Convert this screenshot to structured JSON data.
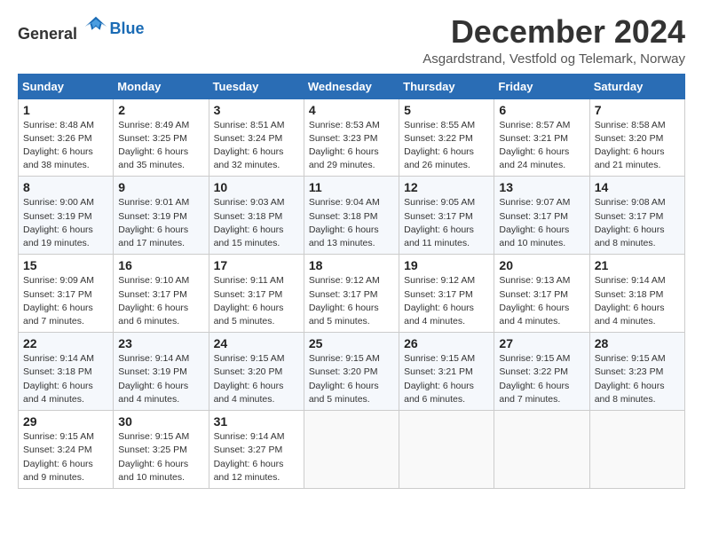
{
  "header": {
    "logo_general": "General",
    "logo_blue": "Blue",
    "title": "December 2024",
    "subtitle": "Asgardstrand, Vestfold og Telemark, Norway"
  },
  "weekdays": [
    "Sunday",
    "Monday",
    "Tuesday",
    "Wednesday",
    "Thursday",
    "Friday",
    "Saturday"
  ],
  "weeks": [
    [
      {
        "day": 1,
        "sunrise": "Sunrise: 8:48 AM",
        "sunset": "Sunset: 3:26 PM",
        "daylight": "Daylight: 6 hours and 38 minutes."
      },
      {
        "day": 2,
        "sunrise": "Sunrise: 8:49 AM",
        "sunset": "Sunset: 3:25 PM",
        "daylight": "Daylight: 6 hours and 35 minutes."
      },
      {
        "day": 3,
        "sunrise": "Sunrise: 8:51 AM",
        "sunset": "Sunset: 3:24 PM",
        "daylight": "Daylight: 6 hours and 32 minutes."
      },
      {
        "day": 4,
        "sunrise": "Sunrise: 8:53 AM",
        "sunset": "Sunset: 3:23 PM",
        "daylight": "Daylight: 6 hours and 29 minutes."
      },
      {
        "day": 5,
        "sunrise": "Sunrise: 8:55 AM",
        "sunset": "Sunset: 3:22 PM",
        "daylight": "Daylight: 6 hours and 26 minutes."
      },
      {
        "day": 6,
        "sunrise": "Sunrise: 8:57 AM",
        "sunset": "Sunset: 3:21 PM",
        "daylight": "Daylight: 6 hours and 24 minutes."
      },
      {
        "day": 7,
        "sunrise": "Sunrise: 8:58 AM",
        "sunset": "Sunset: 3:20 PM",
        "daylight": "Daylight: 6 hours and 21 minutes."
      }
    ],
    [
      {
        "day": 8,
        "sunrise": "Sunrise: 9:00 AM",
        "sunset": "Sunset: 3:19 PM",
        "daylight": "Daylight: 6 hours and 19 minutes."
      },
      {
        "day": 9,
        "sunrise": "Sunrise: 9:01 AM",
        "sunset": "Sunset: 3:19 PM",
        "daylight": "Daylight: 6 hours and 17 minutes."
      },
      {
        "day": 10,
        "sunrise": "Sunrise: 9:03 AM",
        "sunset": "Sunset: 3:18 PM",
        "daylight": "Daylight: 6 hours and 15 minutes."
      },
      {
        "day": 11,
        "sunrise": "Sunrise: 9:04 AM",
        "sunset": "Sunset: 3:18 PM",
        "daylight": "Daylight: 6 hours and 13 minutes."
      },
      {
        "day": 12,
        "sunrise": "Sunrise: 9:05 AM",
        "sunset": "Sunset: 3:17 PM",
        "daylight": "Daylight: 6 hours and 11 minutes."
      },
      {
        "day": 13,
        "sunrise": "Sunrise: 9:07 AM",
        "sunset": "Sunset: 3:17 PM",
        "daylight": "Daylight: 6 hours and 10 minutes."
      },
      {
        "day": 14,
        "sunrise": "Sunrise: 9:08 AM",
        "sunset": "Sunset: 3:17 PM",
        "daylight": "Daylight: 6 hours and 8 minutes."
      }
    ],
    [
      {
        "day": 15,
        "sunrise": "Sunrise: 9:09 AM",
        "sunset": "Sunset: 3:17 PM",
        "daylight": "Daylight: 6 hours and 7 minutes."
      },
      {
        "day": 16,
        "sunrise": "Sunrise: 9:10 AM",
        "sunset": "Sunset: 3:17 PM",
        "daylight": "Daylight: 6 hours and 6 minutes."
      },
      {
        "day": 17,
        "sunrise": "Sunrise: 9:11 AM",
        "sunset": "Sunset: 3:17 PM",
        "daylight": "Daylight: 6 hours and 5 minutes."
      },
      {
        "day": 18,
        "sunrise": "Sunrise: 9:12 AM",
        "sunset": "Sunset: 3:17 PM",
        "daylight": "Daylight: 6 hours and 5 minutes."
      },
      {
        "day": 19,
        "sunrise": "Sunrise: 9:12 AM",
        "sunset": "Sunset: 3:17 PM",
        "daylight": "Daylight: 6 hours and 4 minutes."
      },
      {
        "day": 20,
        "sunrise": "Sunrise: 9:13 AM",
        "sunset": "Sunset: 3:17 PM",
        "daylight": "Daylight: 6 hours and 4 minutes."
      },
      {
        "day": 21,
        "sunrise": "Sunrise: 9:14 AM",
        "sunset": "Sunset: 3:18 PM",
        "daylight": "Daylight: 6 hours and 4 minutes."
      }
    ],
    [
      {
        "day": 22,
        "sunrise": "Sunrise: 9:14 AM",
        "sunset": "Sunset: 3:18 PM",
        "daylight": "Daylight: 6 hours and 4 minutes."
      },
      {
        "day": 23,
        "sunrise": "Sunrise: 9:14 AM",
        "sunset": "Sunset: 3:19 PM",
        "daylight": "Daylight: 6 hours and 4 minutes."
      },
      {
        "day": 24,
        "sunrise": "Sunrise: 9:15 AM",
        "sunset": "Sunset: 3:20 PM",
        "daylight": "Daylight: 6 hours and 4 minutes."
      },
      {
        "day": 25,
        "sunrise": "Sunrise: 9:15 AM",
        "sunset": "Sunset: 3:20 PM",
        "daylight": "Daylight: 6 hours and 5 minutes."
      },
      {
        "day": 26,
        "sunrise": "Sunrise: 9:15 AM",
        "sunset": "Sunset: 3:21 PM",
        "daylight": "Daylight: 6 hours and 6 minutes."
      },
      {
        "day": 27,
        "sunrise": "Sunrise: 9:15 AM",
        "sunset": "Sunset: 3:22 PM",
        "daylight": "Daylight: 6 hours and 7 minutes."
      },
      {
        "day": 28,
        "sunrise": "Sunrise: 9:15 AM",
        "sunset": "Sunset: 3:23 PM",
        "daylight": "Daylight: 6 hours and 8 minutes."
      }
    ],
    [
      {
        "day": 29,
        "sunrise": "Sunrise: 9:15 AM",
        "sunset": "Sunset: 3:24 PM",
        "daylight": "Daylight: 6 hours and 9 minutes."
      },
      {
        "day": 30,
        "sunrise": "Sunrise: 9:15 AM",
        "sunset": "Sunset: 3:25 PM",
        "daylight": "Daylight: 6 hours and 10 minutes."
      },
      {
        "day": 31,
        "sunrise": "Sunrise: 9:14 AM",
        "sunset": "Sunset: 3:27 PM",
        "daylight": "Daylight: 6 hours and 12 minutes."
      },
      null,
      null,
      null,
      null
    ]
  ]
}
